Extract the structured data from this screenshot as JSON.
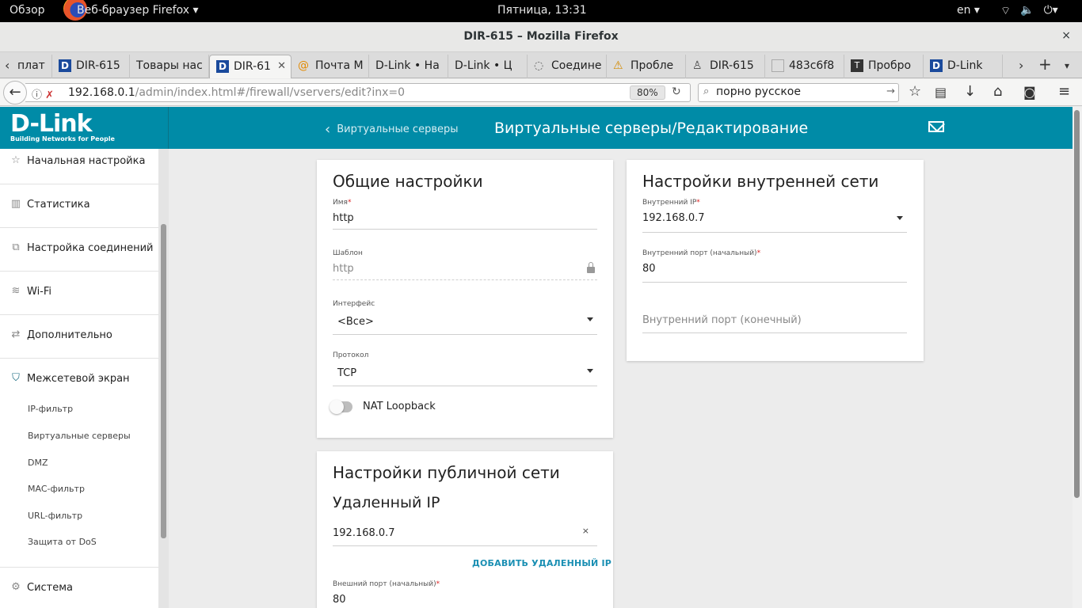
{
  "system_bar": {
    "overview": "Обзор",
    "app_menu": "Веб-браузер Firefox ▾",
    "clock": "Пятница, 13:31",
    "lang": "en ▾"
  },
  "window": {
    "title": "DIR-615 – Mozilla Firefox",
    "close": "×"
  },
  "tabs": [
    {
      "label": "плат"
    },
    {
      "label": "DIR-615"
    },
    {
      "label": "Товары нас"
    },
    {
      "label": "DIR-61",
      "active": true
    },
    {
      "label": "Почта M"
    },
    {
      "label": "D-Link • Ha"
    },
    {
      "label": "D-Link • Ц"
    },
    {
      "label": "Соедине"
    },
    {
      "label": "Пробле"
    },
    {
      "label": "DIR-615"
    },
    {
      "label": "483c6f8"
    },
    {
      "label": "Пробро"
    },
    {
      "label": "D-Link"
    }
  ],
  "navbar": {
    "url_host": "192.168.0.1",
    "url_path": "/admin/index.html#/firewall/vservers/edit?inx=0",
    "zoom": "80%",
    "search_value": "порно русское"
  },
  "header": {
    "brand": "D-Link",
    "tagline": "Building Networks for People",
    "breadcrumb": "Виртуальные серверы",
    "title": "Виртуальные серверы/Редактирование"
  },
  "sidebar": {
    "items": [
      {
        "label": "Начальная настройка",
        "icon": "star-icon"
      },
      {
        "label": "Статистика",
        "icon": "bar-chart-icon"
      },
      {
        "label": "Настройка соединений",
        "icon": "connections-icon"
      },
      {
        "label": "Wi-Fi",
        "icon": "wifi-icon"
      },
      {
        "label": "Дополнительно",
        "icon": "arrows-icon"
      },
      {
        "label": "Межсетевой экран",
        "icon": "shield-icon"
      },
      {
        "label": "Система",
        "icon": "gear-icon"
      }
    ],
    "firewall_sub": [
      "IP-фильтр",
      "Виртуальные серверы",
      "DMZ",
      "MAC-фильтр",
      "URL-фильтр",
      "Защита от DoS"
    ]
  },
  "general": {
    "title": "Общие настройки",
    "name_label": "Имя",
    "name_value": "http",
    "template_label": "Шаблон",
    "template_value": "http",
    "interface_label": "Интерфейс",
    "interface_value": "<Все>",
    "protocol_label": "Протокол",
    "protocol_value": "TCP",
    "nat_loopback": "NAT Loopback",
    "nat_loopback_on": false
  },
  "internal": {
    "title": "Настройки внутренней сети",
    "ip_label": "Внутренний IP",
    "ip_value": "192.168.0.7",
    "port_start_label": "Внутренний порт (начальный)",
    "port_start_value": "80",
    "port_end_placeholder": "Внутренний порт (конечный)"
  },
  "public": {
    "title": "Настройки публичной сети",
    "remote_ip_heading": "Удаленный IP",
    "remote_ip_value": "192.168.0.7",
    "clear": "×",
    "add_remote_ip": "ДОБАВИТЬ УДАЛЕННЫЙ IP",
    "ext_port_start_label": "Внешний порт (начальный)",
    "ext_port_start_value": "80"
  },
  "colors": {
    "brand": "#008ba7",
    "link": "#1a8fb3",
    "required": "#d22222"
  }
}
